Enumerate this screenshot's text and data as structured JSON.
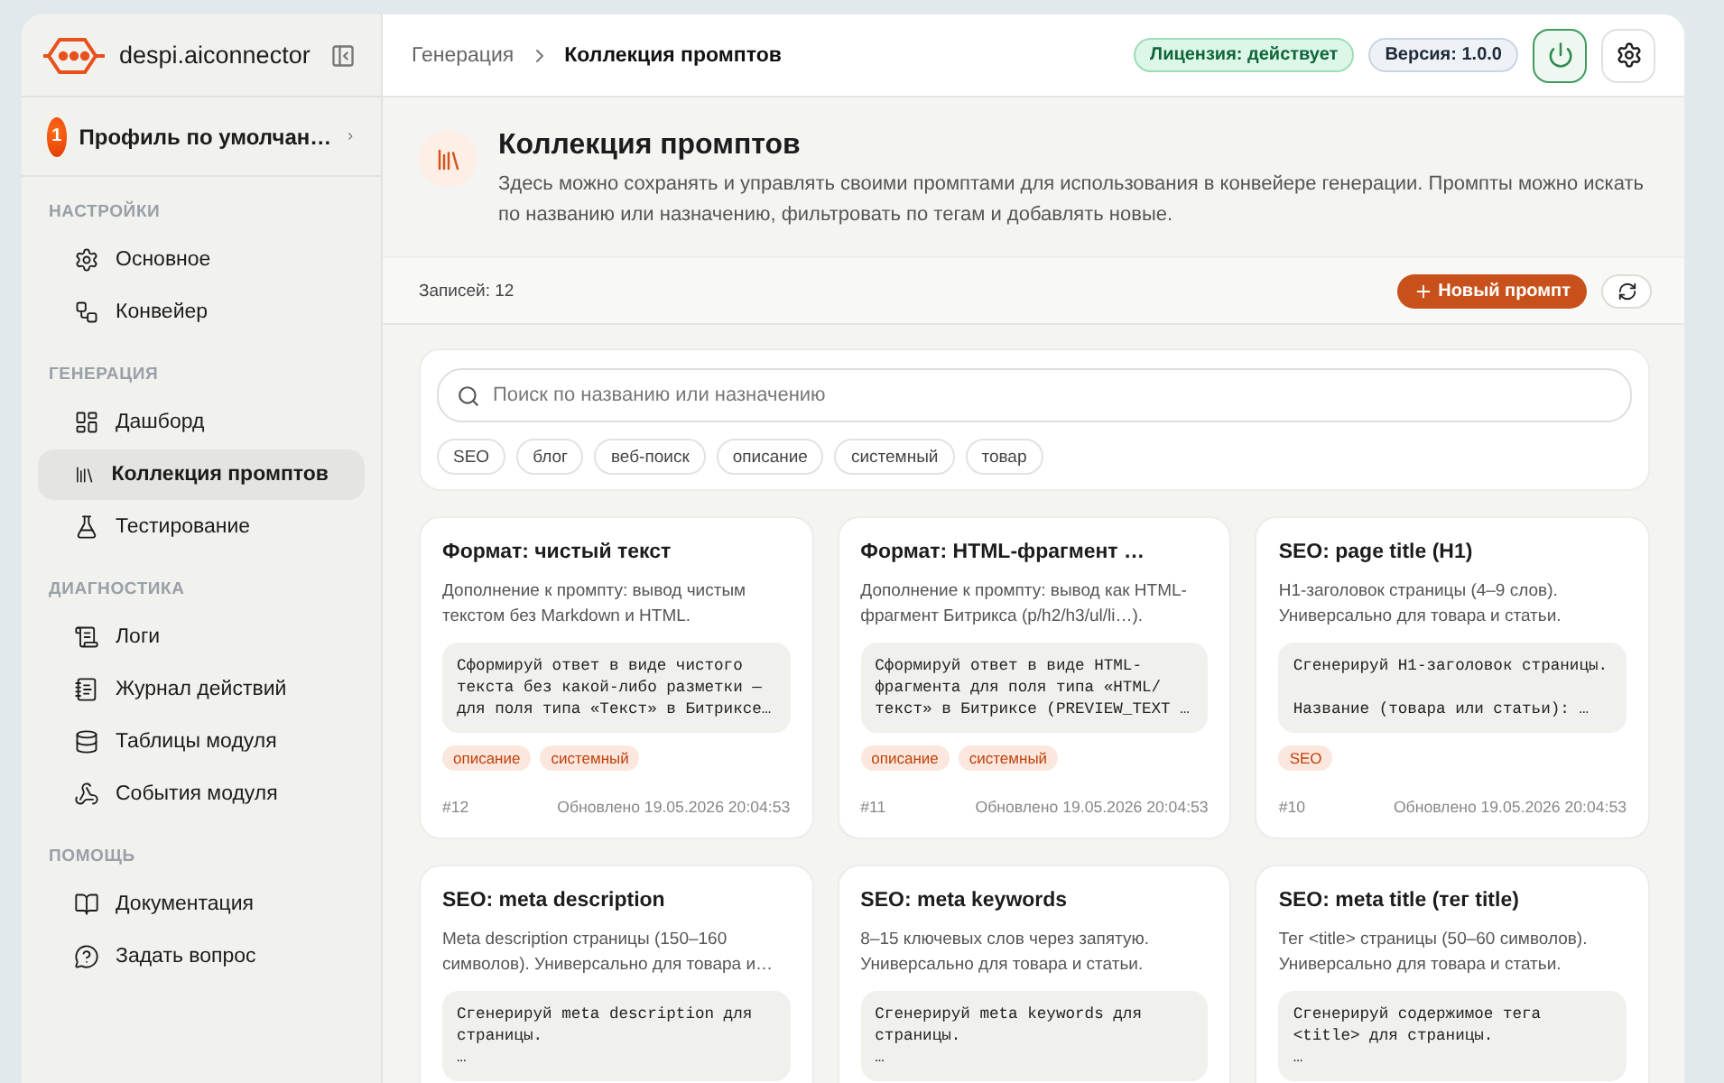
{
  "sidebar": {
    "brand": "despi.aiconnector",
    "profile": {
      "badge": "1",
      "name": "Профиль по умолчан…"
    },
    "sections": [
      {
        "title": "НАСТРОЙКИ",
        "items": [
          {
            "label": "Основное",
            "selected": false
          },
          {
            "label": "Конвейер",
            "selected": false
          }
        ]
      },
      {
        "title": "ГЕНЕРАЦИЯ",
        "items": [
          {
            "label": "Дашборд",
            "selected": false
          },
          {
            "label": "Коллекция промптов",
            "selected": true
          },
          {
            "label": "Тестирование",
            "selected": false
          }
        ]
      },
      {
        "title": "ДИАГНОСТИКА",
        "items": [
          {
            "label": "Логи",
            "selected": false
          },
          {
            "label": "Журнал действий",
            "selected": false
          },
          {
            "label": "Таблицы модуля",
            "selected": false
          },
          {
            "label": "События модуля",
            "selected": false
          }
        ]
      },
      {
        "title": "ПОМОЩЬ",
        "items": [
          {
            "label": "Документация",
            "selected": false
          },
          {
            "label": "Задать вопрос",
            "selected": false
          }
        ]
      }
    ]
  },
  "header": {
    "breadcrumbs": [
      "Генерация",
      "Коллекция промптов"
    ],
    "license": "Лицензия: действует",
    "version": "Версия: 1.0.0"
  },
  "hero": {
    "title": "Коллекция промптов",
    "description": "Здесь можно сохранять и управлять своими промптами для использования в конвейере генерации. Промпты можно искать по названию или назначению, фильтровать по тегам и добавлять новые."
  },
  "toolbar": {
    "count": "Записей: 12",
    "new_button": "Новый промпт"
  },
  "search": {
    "placeholder": "Поиск по названию или назначению",
    "tags": [
      {
        "label": "SEO",
        "selected": false
      },
      {
        "label": "блог",
        "selected": false
      },
      {
        "label": "веб-поиск",
        "selected": false
      },
      {
        "label": "описание",
        "selected": false
      },
      {
        "label": "системный",
        "selected": false
      },
      {
        "label": "товар",
        "selected": false
      }
    ]
  },
  "cards": [
    {
      "title": "Формат: чистый текст",
      "description": "Дополнение к промпту: вывод чистым текстом без Markdown и HTML.",
      "code": "Сформируй ответ в виде чистого\nтекста без какой-либо разметки —\nдля поля типа «Текст» в Битриксе…",
      "tags": [
        "описание",
        "системный"
      ],
      "id": "#12",
      "updated": "Обновлено 19.05.2026 20:04:53"
    },
    {
      "title": "Формат: HTML-фрагмент …",
      "description": "Дополнение к промпту: вывод как HTML-фрагмент Битрикса (p/h2/h3/ul/li…).",
      "code": "Сформируй ответ в виде HTML-\nфрагмента для поля типа «HTML/\nтекст» в Битриксе (PREVIEW_TEXT …",
      "tags": [
        "описание",
        "системный"
      ],
      "id": "#11",
      "updated": "Обновлено 19.05.2026 20:04:53"
    },
    {
      "title": "SEO: page title (H1)",
      "description": "H1-заголовок страницы (4–9 слов). Универсально для товара и статьи.",
      "code": "Сгенерируй H1-заголовок страницы.\n\nНазвание (товара или статьи): …",
      "tags": [
        "SEO"
      ],
      "id": "#10",
      "updated": "Обновлено 19.05.2026 20:04:53"
    },
    {
      "title": "SEO: meta description",
      "description": "Meta description страницы (150–160 символов). Универсально для товара и…",
      "code": "Сгенерируй meta description для\nстраницы.\n…"
    },
    {
      "title": "SEO: meta keywords",
      "description": "8–15 ключевых слов через запятую. Универсально для товара и статьи.",
      "code": "Сгенерируй meta keywords для\nстраницы.\n…"
    },
    {
      "title": "SEO: meta title (тег title)",
      "description": "Тег <title> страницы (50–60 символов). Универсально для товара и статьи.",
      "code": "Сгенерируй содержимое тега\n<title> для страницы.\n…"
    }
  ]
}
